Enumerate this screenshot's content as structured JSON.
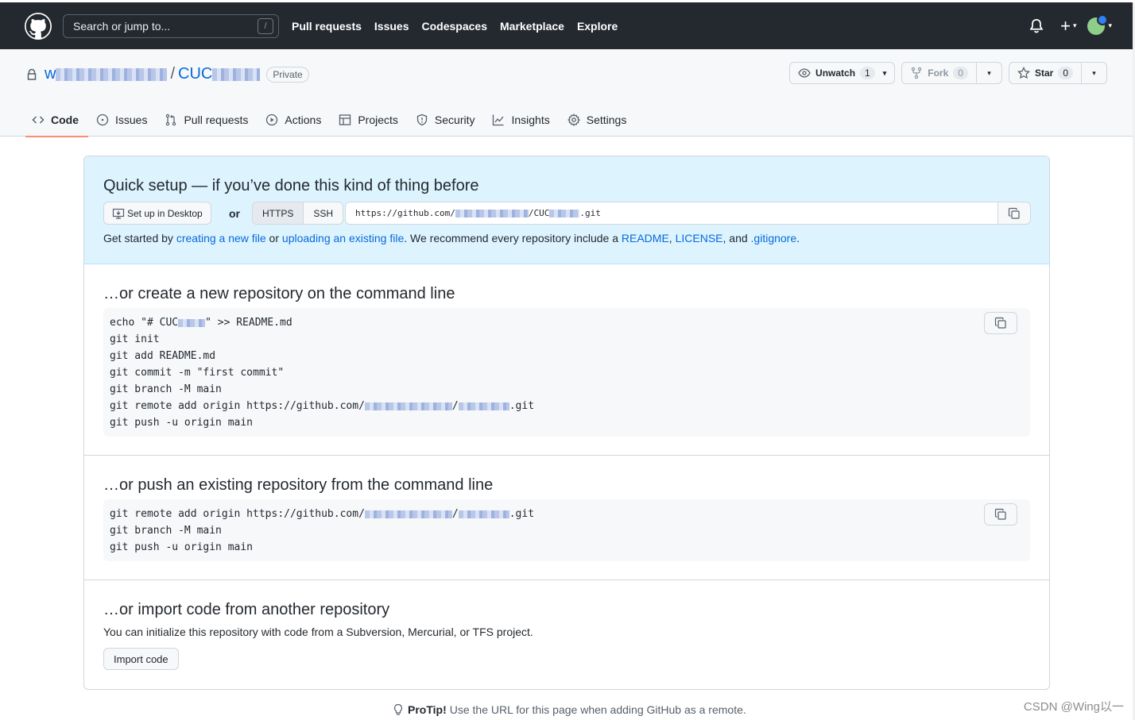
{
  "header": {
    "search_placeholder": "Search or jump to...",
    "search_shortcut": "/",
    "nav": [
      "Pull requests",
      "Issues",
      "Codespaces",
      "Marketplace",
      "Explore"
    ],
    "plus": "+",
    "caret": "▾"
  },
  "repo": {
    "owner_visible": "w",
    "separator": "/",
    "name_visible": "CUC",
    "visibility": "Private",
    "unwatch_label": "Unwatch",
    "unwatch_count": "1",
    "fork_label": "Fork",
    "fork_count": "0",
    "star_label": "Star",
    "star_count": "0"
  },
  "tabs": [
    {
      "label": "Code",
      "icon": "code-icon",
      "active": true
    },
    {
      "label": "Issues",
      "icon": "issue-icon"
    },
    {
      "label": "Pull requests",
      "icon": "pull-request-icon"
    },
    {
      "label": "Actions",
      "icon": "play-icon"
    },
    {
      "label": "Projects",
      "icon": "table-icon"
    },
    {
      "label": "Security",
      "icon": "shield-icon"
    },
    {
      "label": "Insights",
      "icon": "graph-icon"
    },
    {
      "label": "Settings",
      "icon": "gear-icon"
    }
  ],
  "quick_setup": {
    "title": "Quick setup — if you’ve done this kind of thing before",
    "desktop_button": "Set up in Desktop",
    "or": "or",
    "https": "HTTPS",
    "ssh": "SSH",
    "url_prefix": "https://github.com/",
    "url_mid": "/CUC",
    "url_suffix": ".git",
    "text_1": "Get started by ",
    "link_new_file": "creating a new file",
    "text_2": " or ",
    "link_upload": "uploading an existing file",
    "text_3": ". We recommend every repository include a ",
    "link_readme": "README",
    "text_4": ", ",
    "link_license": "LICENSE",
    "text_5": ", and ",
    "link_gitignore": ".gitignore",
    "text_6": "."
  },
  "create_section": {
    "title": "…or create a new repository on the command line",
    "lines": [
      "echo \"# CUC",
      "git init",
      "git add README.md",
      "git commit -m \"first commit\"",
      "git branch -M main",
      "git remote add origin https://github.com/",
      "git push -u origin main"
    ],
    "line1_tail": "\" >> README.md",
    "line6_tail": ".git"
  },
  "push_section": {
    "title": "…or push an existing repository from the command line",
    "lines": [
      "git remote add origin https://github.com/",
      "git branch -M main",
      "git push -u origin main"
    ],
    "line1_tail": ".git"
  },
  "import_section": {
    "title": "…or import code from another repository",
    "description": "You can initialize this repository with code from a Subversion, Mercurial, or TFS project.",
    "button": "Import code"
  },
  "protip": {
    "label": "ProTip!",
    "text": "Use the URL for this page when adding GitHub as a remote."
  },
  "watermark": "CSDN @Wing以一",
  "colors": {
    "header_bg": "#24292f",
    "link": "#0969da",
    "tab_underline": "#fd8c73",
    "quick_bg": "#ddf4ff"
  }
}
